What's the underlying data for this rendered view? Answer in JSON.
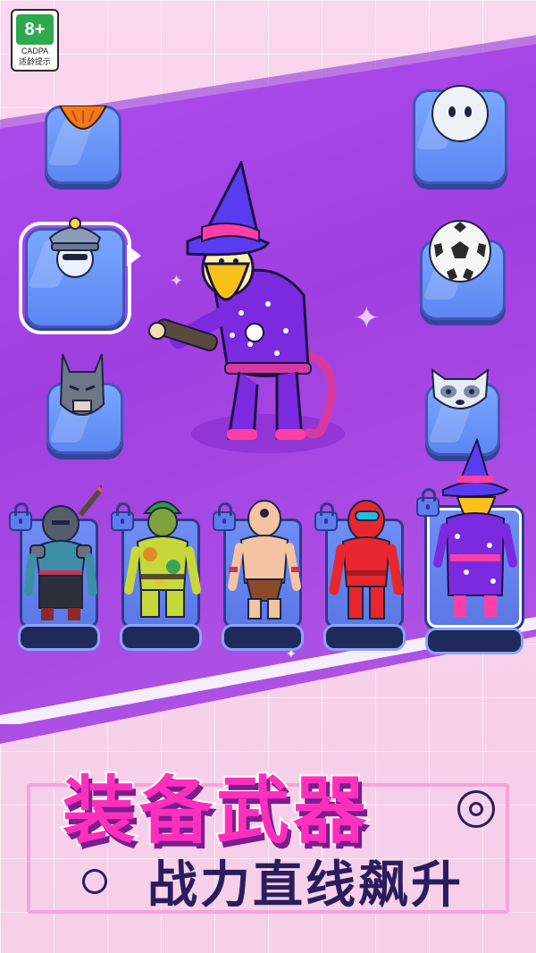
{
  "rating": {
    "age": "8+",
    "org": "CADPA",
    "tip": "适龄提示"
  },
  "headline": {
    "main": "装备武器",
    "sub": "战力直线飙升"
  },
  "left_items": [
    {
      "name": "pumpkin-head",
      "selected": false
    },
    {
      "name": "police-cap-head",
      "selected": true
    },
    {
      "name": "bat-mask-head",
      "selected": false
    }
  ],
  "right_items": [
    {
      "name": "ghost-head"
    },
    {
      "name": "soccer-ball-head"
    },
    {
      "name": "raccoon-head"
    }
  ],
  "characters": [
    {
      "name": "knight",
      "locked": true
    },
    {
      "name": "camo-soldier",
      "locked": true
    },
    {
      "name": "cyclops-barbarian",
      "locked": true
    },
    {
      "name": "red-crewmate",
      "locked": true
    },
    {
      "name": "wizard",
      "locked": true,
      "active": true
    }
  ],
  "colors": {
    "accent_pink": "#ff2fbe",
    "band_purple": "#a03fe0",
    "slot_blue": "#6a95ff"
  }
}
